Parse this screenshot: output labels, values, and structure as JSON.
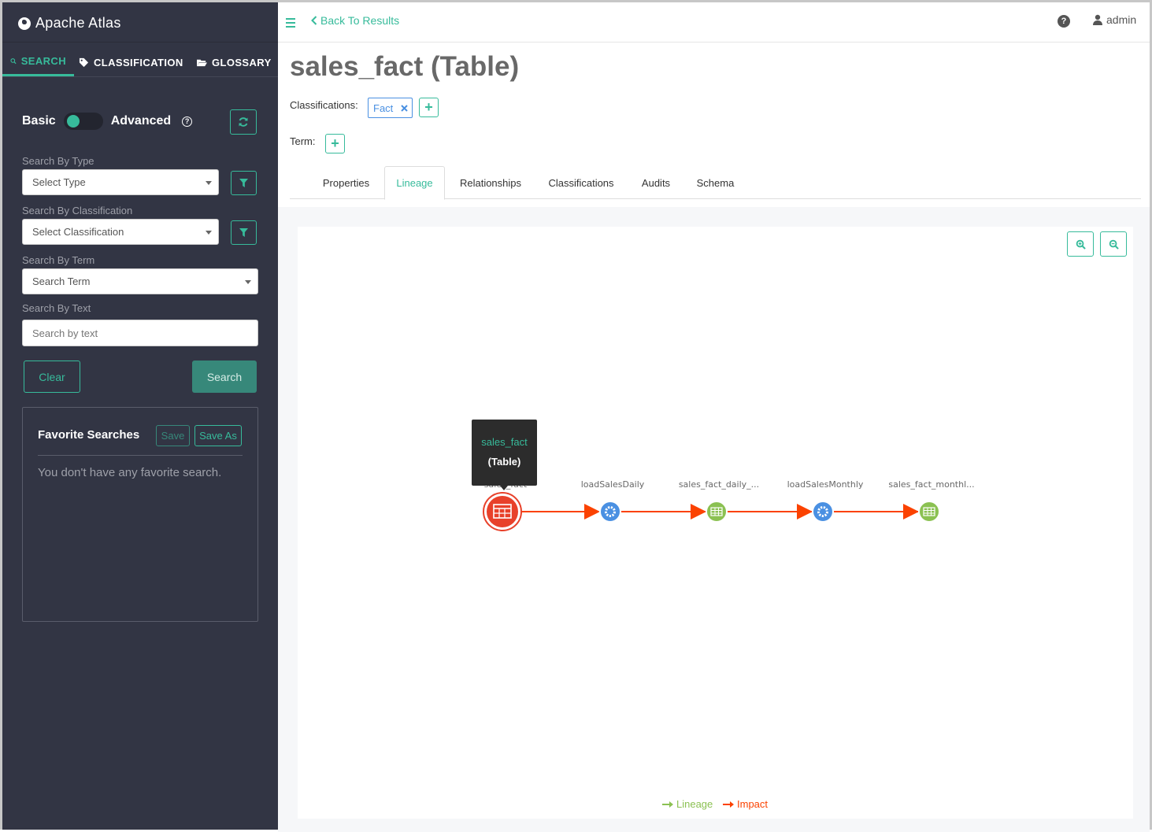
{
  "app": {
    "title": "Apache Atlas"
  },
  "sidebar": {
    "tabs": [
      {
        "label": "SEARCH",
        "icon": "search-icon",
        "active": true
      },
      {
        "label": "CLASSIFICATION",
        "icon": "tag-icon",
        "active": false
      },
      {
        "label": "GLOSSARY",
        "icon": "folder-open-icon",
        "active": false
      }
    ],
    "toggle": {
      "left": "Basic",
      "right": "Advanced",
      "state": "Basic"
    },
    "fields": {
      "type_label": "Search By Type",
      "type_placeholder": "Select Type",
      "classification_label": "Search By Classification",
      "classification_placeholder": "Select Classification",
      "term_label": "Search By Term",
      "term_placeholder": "Search Term",
      "text_label": "Search By Text",
      "text_placeholder": "Search by text"
    },
    "buttons": {
      "clear": "Clear",
      "search": "Search"
    },
    "favorites": {
      "title": "Favorite Searches",
      "save": "Save",
      "save_as": "Save As",
      "empty": "You don't have any favorite search."
    }
  },
  "header": {
    "back": "Back To Results",
    "user": "admin"
  },
  "entity": {
    "title": "sales_fact (Table)",
    "classifications_label": "Classifications:",
    "classification_tag": "Fact",
    "term_label": "Term:"
  },
  "tabs": [
    {
      "label": "Properties",
      "active": false
    },
    {
      "label": "Lineage",
      "active": true
    },
    {
      "label": "Relationships",
      "active": false
    },
    {
      "label": "Classifications",
      "active": false
    },
    {
      "label": "Audits",
      "active": false
    },
    {
      "label": "Schema",
      "active": false
    }
  ],
  "lineage": {
    "nodes": [
      {
        "name": "sales_fact",
        "kind": "table",
        "current": true
      },
      {
        "name": "loadSalesDaily",
        "kind": "process"
      },
      {
        "name": "sales_fact_daily_...",
        "kind": "table"
      },
      {
        "name": "loadSalesMonthly",
        "kind": "process"
      },
      {
        "name": "sales_fact_monthl...",
        "kind": "table"
      }
    ],
    "tooltip": {
      "name": "sales_fact",
      "type": "(Table)"
    },
    "legend": {
      "lineage": "Lineage",
      "impact": "Impact"
    },
    "colors": {
      "lineage": "#8bc152",
      "impact": "#fb4200",
      "process": "#4a90e2",
      "table": "#8bc152",
      "current": "#e8412a",
      "accent": "#37bb9b"
    }
  }
}
